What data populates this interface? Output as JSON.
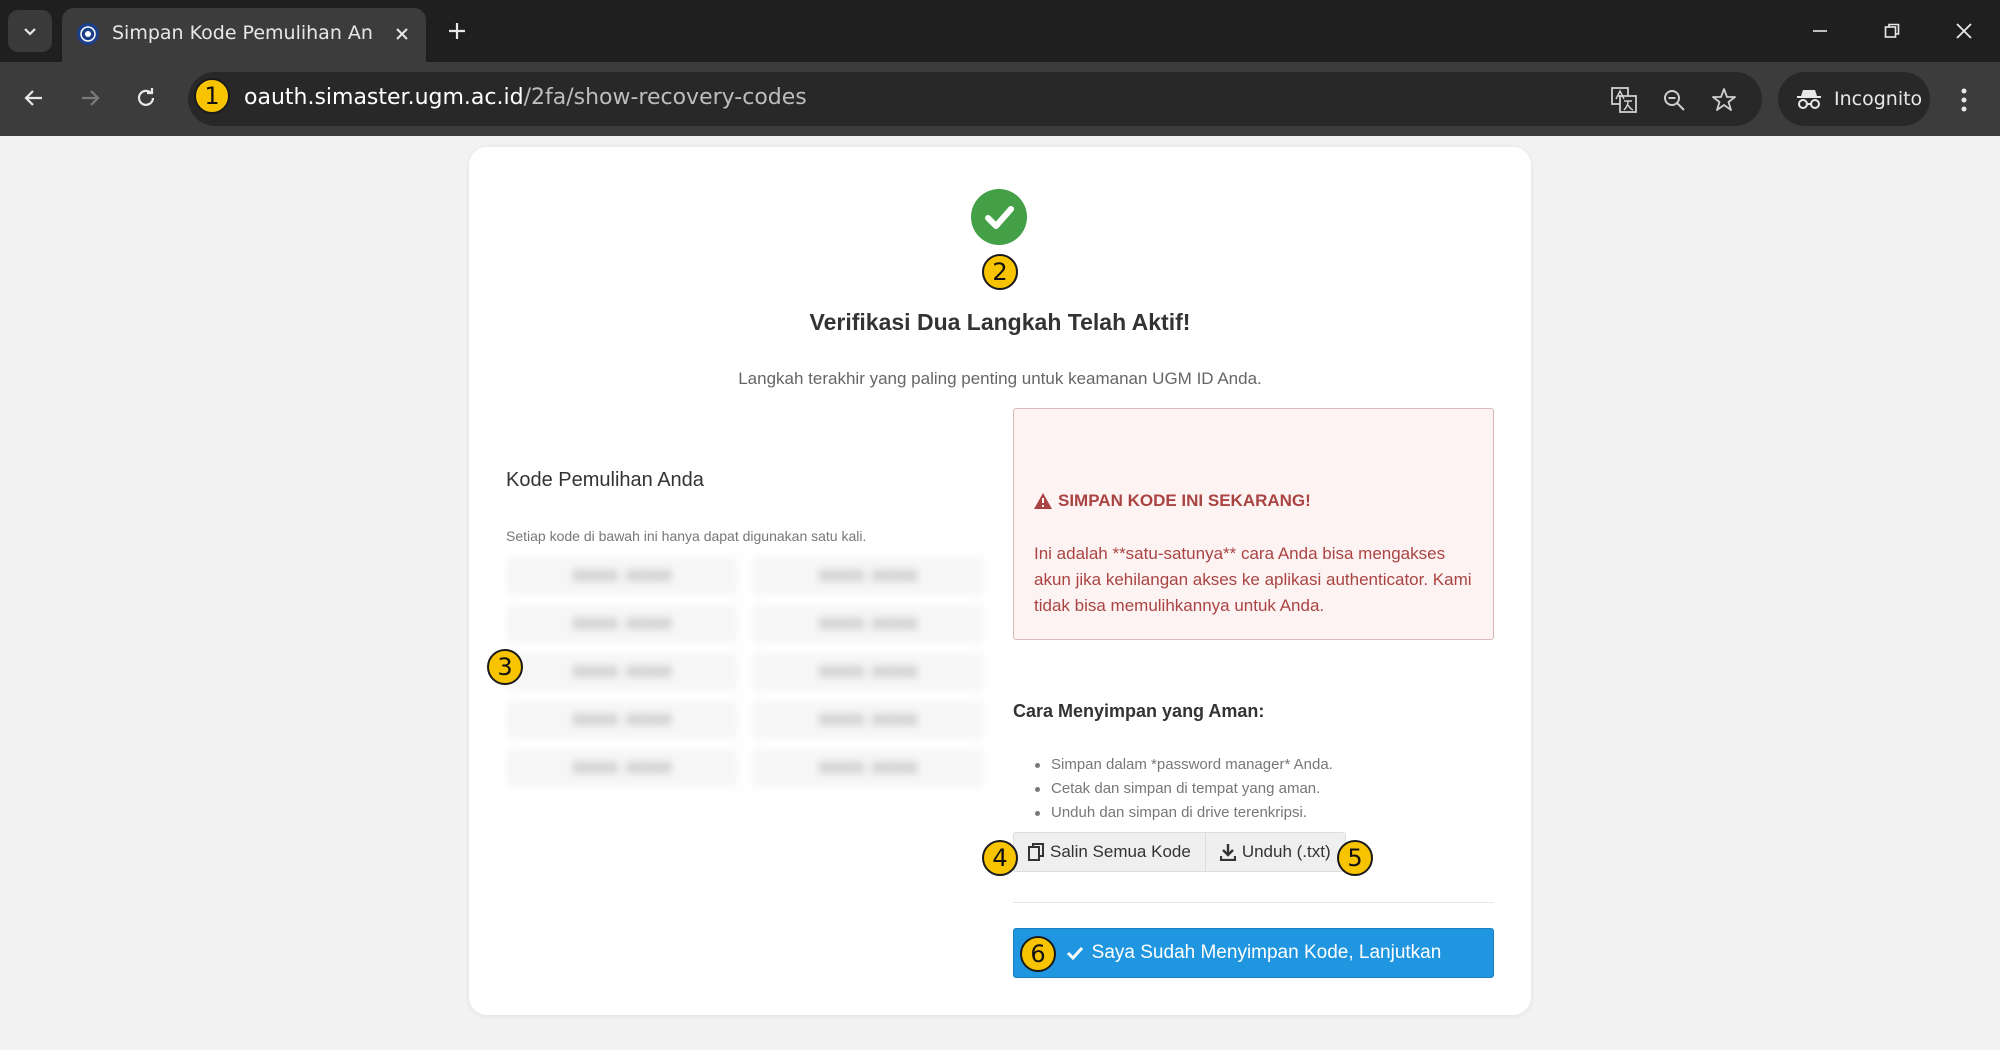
{
  "browser": {
    "tab_title": "Simpan Kode Pemulihan Anda",
    "url_host": "oauth.simaster.ugm.ac.id",
    "url_path": "/2fa/show-recovery-codes",
    "incognito_label": "Incognito"
  },
  "page": {
    "title": "Verifikasi Dua Langkah Telah Aktif!",
    "subtitle": "Langkah terakhir yang paling penting untuk keamanan UGM ID Anda.",
    "codes_title": "Kode Pemulihan Anda",
    "codes_note": "Setiap kode di bawah ini hanya dapat digunakan satu kali.",
    "codes": [
      "XXXXX-XXXXX",
      "XXXXX-XXXXX",
      "XXXXX-XXXXX",
      "XXXXX-XXXXX",
      "XXXXX-XXXXX",
      "XXXXX-XXXXX",
      "XXXXX-XXXXX",
      "XXXXX-XXXXX",
      "XXXXX-XXXXX",
      "XXXXX-XXXXX"
    ],
    "warning_title": "SIMPAN KODE INI SEKARANG!",
    "warning_text": "Ini adalah **satu-satunya** cara Anda bisa mengakses akun jika kehilangan akses ke aplikasi authenticator. Kami tidak bisa memulihkannya untuk Anda.",
    "howto_title": "Cara Menyimpan yang Aman:",
    "howto_items": [
      "Simpan dalam *password manager* Anda.",
      "Cetak dan simpan di tempat yang aman.",
      "Unduh dan simpan di drive terenkripsi."
    ],
    "copy_button": "Salin Semua Kode",
    "download_button": "Unduh (.txt)",
    "continue_button": "Saya Sudah Menyimpan Kode, Lanjutkan"
  },
  "markers": [
    "1",
    "2",
    "3",
    "4",
    "5",
    "6"
  ],
  "colors": {
    "success": "#44a047",
    "warning_text": "#a94442",
    "primary": "#2196e0",
    "marker": "#f8c400"
  }
}
